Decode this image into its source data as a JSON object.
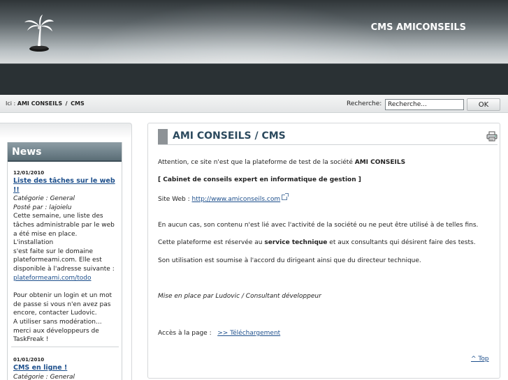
{
  "header": {
    "site_title": "CMS AMICONSEILS"
  },
  "breadcrumb": {
    "prefix": "Ici :",
    "items": [
      "AMI CONSEILS",
      "CMS"
    ],
    "separator": "/"
  },
  "search": {
    "label": "Recherche:",
    "value": "Recherche...",
    "button_label": "OK"
  },
  "news": {
    "title": "News",
    "items": [
      {
        "date": "12/01/2010",
        "title": "Liste des tâches sur le web !!",
        "category": "Catégorie : General",
        "author": "Posté par : lajoielu",
        "lines": [
          "Cette semaine, une liste des",
          "tâches administrable par le web",
          "a été mise en place. L'installation",
          "s'est faite sur le domaine",
          "plateformeami.com. Elle est",
          "disponible à l'adresse suivante :"
        ],
        "link": "plateformeami.com/todo",
        "lines2": [
          "Pour obtenir un login et un mot",
          "de passe si vous n'en avez pas",
          "encore, contacter Ludovic.",
          "A utiliser sans modération...",
          "merci aux développeurs de",
          "TaskFreak !"
        ]
      },
      {
        "date": "01/01/2010",
        "title": "CMS en ligne !",
        "category": "Catégorie : General"
      }
    ]
  },
  "main": {
    "title": "AMI CONSEILS / CMS",
    "intro_text": "Attention, ce site n'est que la plateforme de test de la société ",
    "intro_bold": "AMI CONSEILS",
    "tagline": "[ Cabinet de conseils expert en informatique de gestion ]",
    "website_label": "Site Web : ",
    "website_link": "http://www.amiconseils.com",
    "disclaimer": "En aucun cas, son contenu n'est lié avec l'activité de la société ou ne peut être utilisé à de telles fins.",
    "reserved_pre": "Cette plateforme est réservée au ",
    "reserved_bold": "service technique",
    "reserved_post": " et aux consultants qui désirent faire des tests.",
    "approval": "Son utilisation est soumise à l'accord du dirigeant ainsi que du directeur technique.",
    "credit": "Mise en place par Ludovic / Consultant développeur",
    "access_label": "Accès à la page :",
    "access_link": ">> Téléchargement",
    "top_link": "^ Top"
  }
}
